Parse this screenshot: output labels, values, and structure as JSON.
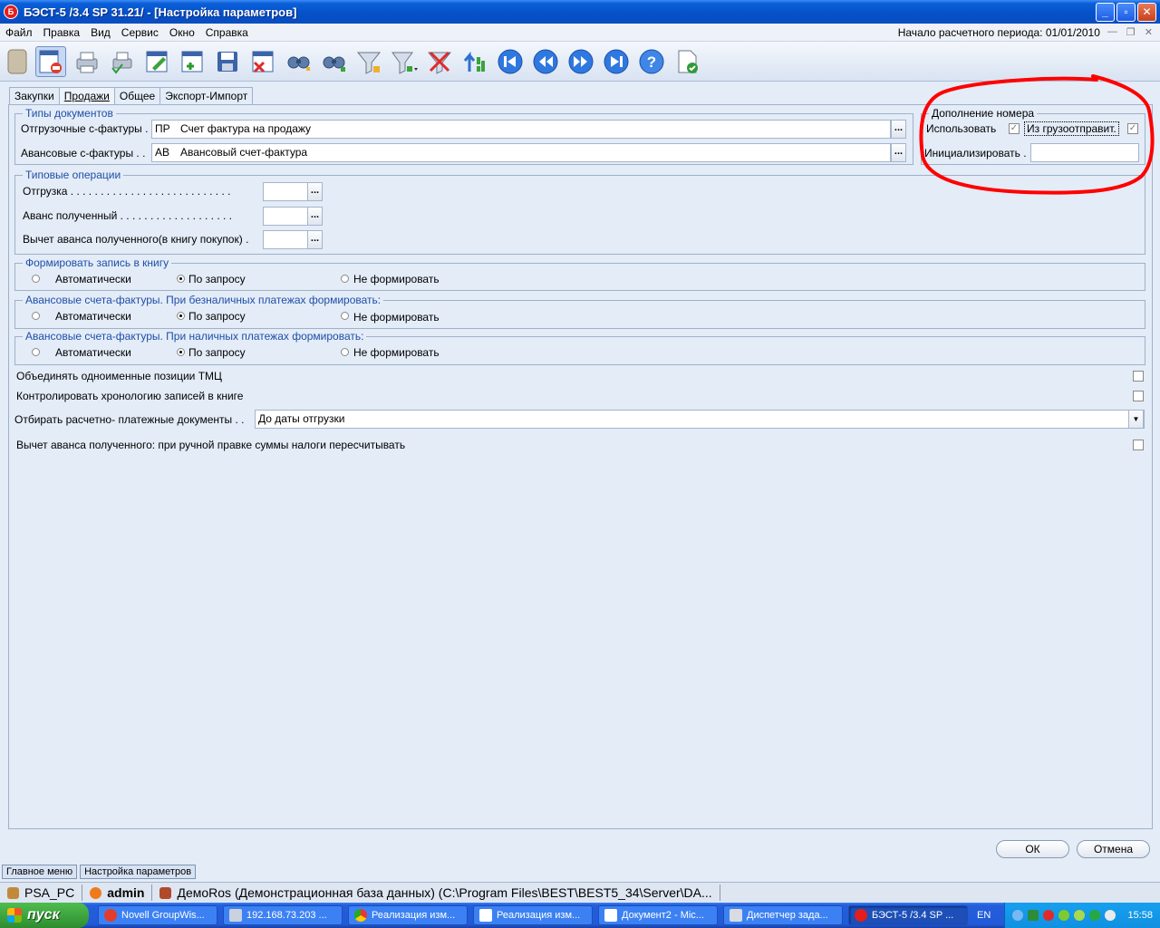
{
  "window": {
    "title": "БЭСТ-5 /3.4 SP 31.21/ - [Настройка параметров]",
    "app_icon_letter": "Б",
    "min": "_",
    "max": "▫",
    "close": "✕"
  },
  "menu": {
    "items": [
      "Файл",
      "Правка",
      "Вид",
      "Сервис",
      "Окно",
      "Справка"
    ],
    "period": "Начало расчетного периода: 01/01/2010",
    "mdi_min": "—",
    "mdi_restore": "❐",
    "mdi_close": "✕"
  },
  "tabs": [
    "Закупки",
    "Продажи",
    "Общее",
    "Экспорт-Импорт"
  ],
  "doc_types": {
    "title": "Типы документов",
    "rows": [
      {
        "label": "Отгрузочные с-фактуры .",
        "code": "ПР",
        "value": "Счет фактура на продажу"
      },
      {
        "label": "Авансовые с-фактуры . .",
        "code": "АВ",
        "value": "Авансовый счет-фактура"
      }
    ]
  },
  "numbering": {
    "title": "Дополнение номера",
    "use_label": "Использовать",
    "from_label": "Из грузоотправит.",
    "init_label": "Инициализировать ."
  },
  "operations": {
    "title": "Типовые операции",
    "rows": [
      "Отгрузка . . . . . . . . . . . . . . . . . . . . . . . . . . .",
      "Аванс полученный  . . . . . . . . . . . . . . . . . . .",
      "Вычет аванса полученного(в книгу покупок) ."
    ]
  },
  "radio_groups": [
    {
      "title": "Формировать запись в книгу",
      "options": [
        "Автоматически",
        "По запросу",
        "Не формировать"
      ],
      "selected": 1
    },
    {
      "title": "Авансовые счета-фактуры.  При безналичных платежах формировать:",
      "options": [
        "Автоматически",
        "По запросу",
        "Не формировать"
      ],
      "selected": 1
    },
    {
      "title": "Авансовые счета-фактуры.  При наличных платежах формировать:",
      "options": [
        "Автоматически",
        "По запросу",
        "Не формировать"
      ],
      "selected": 1
    }
  ],
  "checks": {
    "merge": "Объединять одноименные позиции ТМЦ",
    "chronology": "Контролировать хронологию записей в книге",
    "recalc": "Вычет аванса полученного: при ручной правке суммы налоги пересчитывать"
  },
  "select_docs": {
    "label": "Отбирать расчетно- платежные документы . .",
    "value": "До даты отгрузки"
  },
  "ellipsis": "...",
  "check_mark": "✓",
  "dropdown_arrow": "▼",
  "buttons": {
    "ok": "ОК",
    "cancel": "Отмена"
  },
  "window_tabs": [
    "Главное меню",
    "Настройка параметров"
  ],
  "status": {
    "pc": "PSA_PC",
    "user": "admin",
    "db": "ДемоRos (Демонстрационная база данных) (C:\\Program Files\\BEST\\BEST5_34\\Server\\DA..."
  },
  "taskbar": {
    "start": "пуск",
    "tasks": [
      "Novell GroupWis...",
      "192.168.73.203 ...",
      "Реализация изм...",
      "Реализация изм...",
      "Документ2 - Mic...",
      "Диспетчер зада...",
      "БЭСТ-5 /3.4 SP ..."
    ],
    "lang": "EN",
    "time": "15:58"
  },
  "colors": {
    "accent_title": "#1f4ea8",
    "annotation": "#ff0000"
  }
}
